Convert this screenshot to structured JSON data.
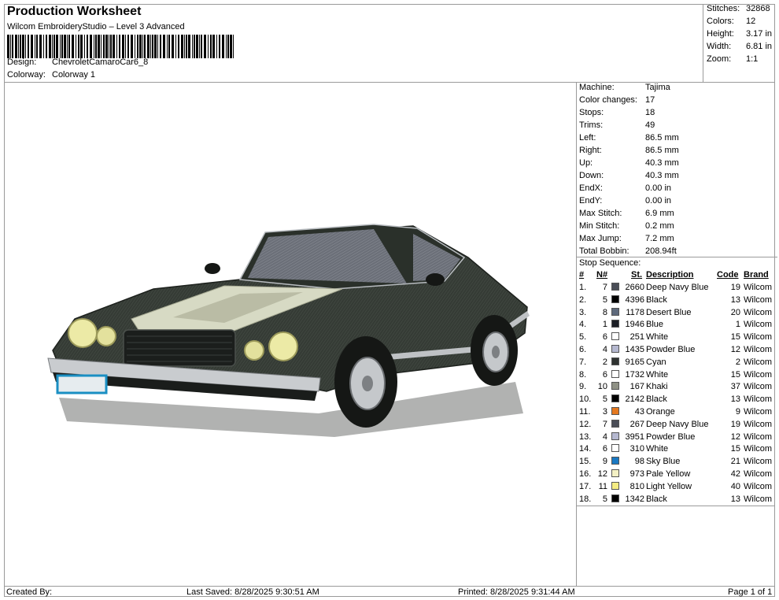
{
  "header": {
    "title": "Production Worksheet",
    "subtitle": "Wilcom EmbroideryStudio – Level 3 Advanced",
    "design_label": "Design:",
    "design_value": "ChevroletCamaroCar6_8",
    "colorway_label": "Colorway:",
    "colorway_value": "Colorway 1"
  },
  "stats": {
    "stitches_label": "Stitches:",
    "stitches": "32868",
    "colors_label": "Colors:",
    "colors": "12",
    "height_label": "Height:",
    "height": "3.17 in",
    "width_label": "Width:",
    "width": "6.81 in",
    "zoom_label": "Zoom:",
    "zoom": "1:1"
  },
  "machine_info": [
    {
      "label": "Machine:",
      "value": "Tajima"
    },
    {
      "label": "Color changes:",
      "value": "17"
    },
    {
      "label": "Stops:",
      "value": "18"
    },
    {
      "label": "Trims:",
      "value": "49"
    },
    {
      "label": "Left:",
      "value": "86.5 mm"
    },
    {
      "label": "Right:",
      "value": "86.5 mm"
    },
    {
      "label": "Up:",
      "value": "40.3 mm"
    },
    {
      "label": "Down:",
      "value": "40.3 mm"
    },
    {
      "label": "EndX:",
      "value": "0.00 in"
    },
    {
      "label": "EndY:",
      "value": "0.00 in"
    },
    {
      "label": "Max Stitch:",
      "value": "6.9 mm"
    },
    {
      "label": "Min Stitch:",
      "value": "0.2 mm"
    },
    {
      "label": "Max Jump:",
      "value": "7.2 mm"
    },
    {
      "label": "Total Bobbin:",
      "value": "208.94ft"
    }
  ],
  "stop_sequence": {
    "title": "Stop Sequence:",
    "headers": {
      "num": "#",
      "needle": "N#",
      "stitches": "St.",
      "description": "Description",
      "code": "Code",
      "brand": "Brand"
    },
    "rows": [
      {
        "num": "1.",
        "needle": "7",
        "stitches": "2660",
        "description": "Deep Navy Blue",
        "code": "19",
        "brand": "Wilcom",
        "color": "#4a4d57"
      },
      {
        "num": "2.",
        "needle": "5",
        "stitches": "4396",
        "description": "Black",
        "code": "13",
        "brand": "Wilcom",
        "color": "#000000"
      },
      {
        "num": "3.",
        "needle": "8",
        "stitches": "1178",
        "description": "Desert Blue",
        "code": "20",
        "brand": "Wilcom",
        "color": "#5e6a7c"
      },
      {
        "num": "4.",
        "needle": "1",
        "stitches": "1946",
        "description": "Blue",
        "code": "1",
        "brand": "Wilcom",
        "color": "#1c1f26"
      },
      {
        "num": "5.",
        "needle": "6",
        "stitches": "251",
        "description": "White",
        "code": "15",
        "brand": "Wilcom",
        "color": "#ffffff"
      },
      {
        "num": "6.",
        "needle": "4",
        "stitches": "1435",
        "description": "Powder Blue",
        "code": "12",
        "brand": "Wilcom",
        "color": "#b5b8d0"
      },
      {
        "num": "7.",
        "needle": "2",
        "stitches": "9165",
        "description": "Cyan",
        "code": "2",
        "brand": "Wilcom",
        "color": "#2f3331"
      },
      {
        "num": "8.",
        "needle": "6",
        "stitches": "1732",
        "description": "White",
        "code": "15",
        "brand": "Wilcom",
        "color": "#ffffff"
      },
      {
        "num": "9.",
        "needle": "10",
        "stitches": "167",
        "description": "Khaki",
        "code": "37",
        "brand": "Wilcom",
        "color": "#8f9185"
      },
      {
        "num": "10.",
        "needle": "5",
        "stitches": "2142",
        "description": "Black",
        "code": "13",
        "brand": "Wilcom",
        "color": "#000000"
      },
      {
        "num": "11.",
        "needle": "3",
        "stitches": "43",
        "description": "Orange",
        "code": "9",
        "brand": "Wilcom",
        "color": "#e4781f"
      },
      {
        "num": "12.",
        "needle": "7",
        "stitches": "267",
        "description": "Deep Navy Blue",
        "code": "19",
        "brand": "Wilcom",
        "color": "#4a4d57"
      },
      {
        "num": "13.",
        "needle": "4",
        "stitches": "3951",
        "description": "Powder Blue",
        "code": "12",
        "brand": "Wilcom",
        "color": "#b5b8d0"
      },
      {
        "num": "14.",
        "needle": "6",
        "stitches": "310",
        "description": "White",
        "code": "15",
        "brand": "Wilcom",
        "color": "#ffffff"
      },
      {
        "num": "15.",
        "needle": "9",
        "stitches": "98",
        "description": "Sky Blue",
        "code": "21",
        "brand": "Wilcom",
        "color": "#1a78c2"
      },
      {
        "num": "16.",
        "needle": "12",
        "stitches": "973",
        "description": "Pale Yellow",
        "code": "42",
        "brand": "Wilcom",
        "color": "#f3f0c4"
      },
      {
        "num": "17.",
        "needle": "11",
        "stitches": "810",
        "description": "Light Yellow",
        "code": "40",
        "brand": "Wilcom",
        "color": "#f4ec83"
      },
      {
        "num": "18.",
        "needle": "5",
        "stitches": "1342",
        "description": "Black",
        "code": "13",
        "brand": "Wilcom",
        "color": "#000000"
      }
    ]
  },
  "footer": {
    "created_by": "Created By:",
    "last_saved": "Last Saved: 8/28/2025 9:30:51 AM",
    "printed": "Printed: 8/28/2025 9:31:44 AM",
    "page": "Page 1 of 1"
  }
}
